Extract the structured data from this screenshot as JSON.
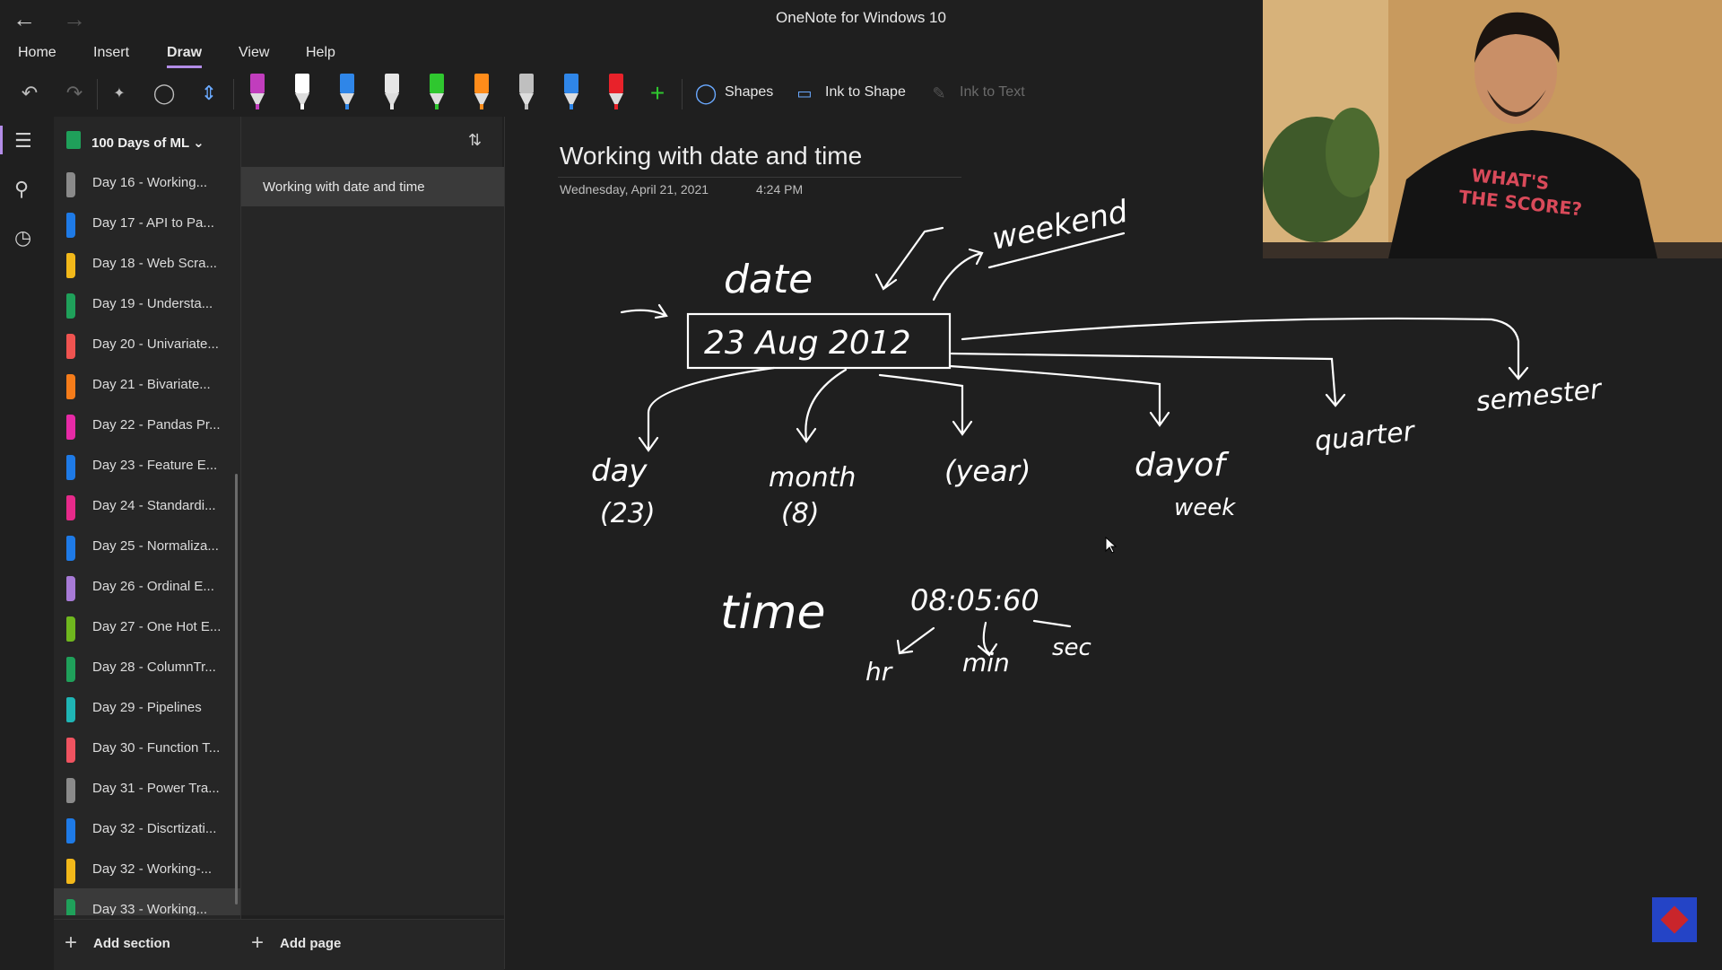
{
  "window": {
    "title": "OneNote for Windows 10"
  },
  "menu": [
    "Home",
    "Insert",
    "Draw",
    "View",
    "Help"
  ],
  "active_menu": "Draw",
  "toolbar": {
    "shapes_label": "Shapes",
    "ink_to_shape_label": "Ink to Shape",
    "ink_to_text_label": "Ink to Text",
    "pens": [
      {
        "color": "#c13dbd"
      },
      {
        "color": "#ffffff"
      },
      {
        "color": "#2f86e8"
      },
      {
        "color": "#e6e6e6"
      },
      {
        "color": "#2fc72f"
      },
      {
        "color": "#ff8c1a"
      },
      {
        "color": "#bfbfbf"
      },
      {
        "color": "#2f86e8"
      },
      {
        "color": "#e8222a"
      }
    ],
    "accent": "#b38de8"
  },
  "notebook": {
    "name": "100 Days of ML"
  },
  "sections": [
    {
      "label": "Day 16 - Working...",
      "color": "#8a8a8a"
    },
    {
      "label": "Day 17 - API to Pa...",
      "color": "#1e7ae6"
    },
    {
      "label": "Day 18 - Web Scra...",
      "color": "#f2b81a"
    },
    {
      "label": "Day 19 - Understa...",
      "color": "#1fa05a"
    },
    {
      "label": "Day 20 - Univariate...",
      "color": "#ef5350"
    },
    {
      "label": "Day 21 - Bivariate...",
      "color": "#f57c1a"
    },
    {
      "label": "Day 22 - Pandas Pr...",
      "color": "#e62aa6"
    },
    {
      "label": "Day 23 - Feature E...",
      "color": "#1e7ae6"
    },
    {
      "label": "Day 24 - Standardi...",
      "color": "#e62a8a"
    },
    {
      "label": "Day 25 - Normaliza...",
      "color": "#1e7ae6"
    },
    {
      "label": "Day 26 - Ordinal E...",
      "color": "#a77ad6"
    },
    {
      "label": "Day 27 - One Hot E...",
      "color": "#6fb71e"
    },
    {
      "label": "Day 28 - ColumnTr...",
      "color": "#1fa05a"
    },
    {
      "label": "Day 29 - Pipelines",
      "color": "#1fb5b5"
    },
    {
      "label": "Day 30 - Function T...",
      "color": "#ef5360"
    },
    {
      "label": "Day 31 - Power Tra...",
      "color": "#8a8a8a"
    },
    {
      "label": "Day 32 - Discrtizati...",
      "color": "#1e7ae6"
    },
    {
      "label": "Day 32 - Working-...",
      "color": "#f2b81a"
    },
    {
      "label": "Day 33 - Working...",
      "color": "#1fa05a"
    }
  ],
  "active_section": "Day 33 - Working...",
  "pages": [
    {
      "label": "Working with date and time"
    }
  ],
  "add_section_label": "Add section",
  "add_page_label": "Add page",
  "page": {
    "title": "Working with date and time",
    "date": "Wednesday, April 21, 2021",
    "time": "4:24 PM"
  },
  "ink": {
    "date_word": "date",
    "date_value": "23 Aug 2012",
    "weekend": "weekend",
    "day": "day",
    "day_value": "(23)",
    "month": "month",
    "month_value": "(8)",
    "year": "(year)",
    "dayofweek_1": "dayof",
    "dayofweek_2": "week",
    "quarter": "quarter",
    "semester": "semester",
    "time_word": "time",
    "time_value": "08:05:60",
    "hr": "hr",
    "min": "min",
    "sec": "sec"
  },
  "webcam": {
    "shirt_text_1": "WHAT'S",
    "shirt_text_2": "THE SCORE?"
  }
}
